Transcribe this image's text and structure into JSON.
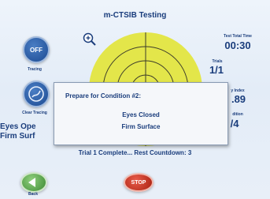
{
  "app": {
    "title": "m-CTSIB Testing"
  },
  "controls": {
    "off_label": "OFF",
    "tracing_label": "Tracing",
    "clear_tracing_label": "Clear Tracing",
    "back_label": "Back",
    "stop_label": "STOP"
  },
  "condition": {
    "line1": "Eyes Ope",
    "line2": "Firm Surf"
  },
  "stats": {
    "total_time_label": "Test Total Time",
    "total_time_value": "00:30",
    "trials_label": "Trials",
    "trials_value": "1/1",
    "sway_index_label": "y Index",
    "sway_index_value": ".89",
    "condition_label": "dition",
    "condition_value": "/4"
  },
  "dialog": {
    "title": "Prepare for Condition #2:",
    "line1": "Eyes Closed",
    "line2": "Firm Surface"
  },
  "status_text": "Trial 1 Complete... Rest Countdown: 3",
  "colors": {
    "accent": "#1a3d7c",
    "target": "#e3e64a",
    "stop": "#c0311d",
    "back": "#5aa848"
  }
}
